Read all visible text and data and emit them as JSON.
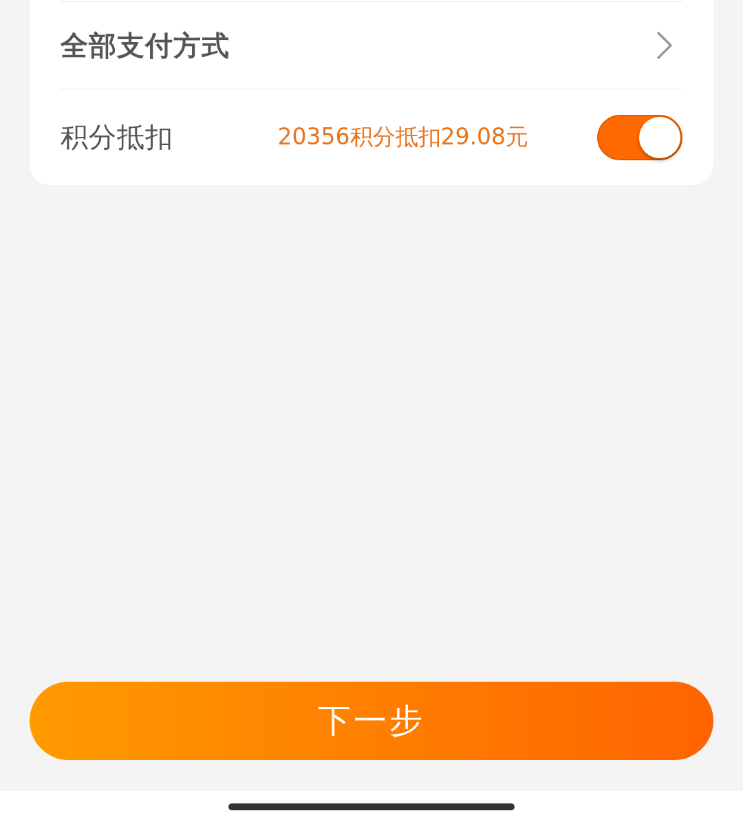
{
  "payment_rows": [
    {
      "kind": "link",
      "label": "全部支付方式"
    },
    {
      "kind": "toggle",
      "label": "积分抵扣",
      "value": "20356积分抵扣29.08元",
      "on": true
    }
  ],
  "next_button": {
    "label": "下一步"
  }
}
